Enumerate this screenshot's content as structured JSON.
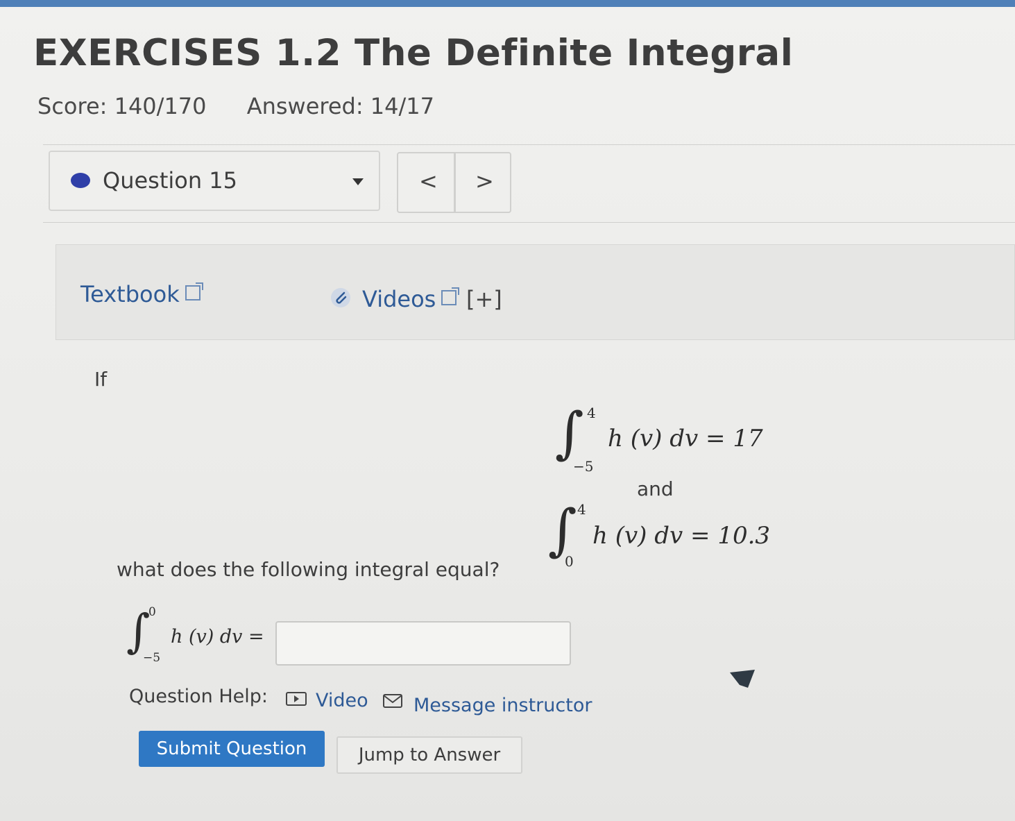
{
  "header": {
    "title": "EXERCISES 1.2 The Definite Integral",
    "score_label": "Score: 140/170",
    "answered_label": "Answered: 14/17"
  },
  "question_nav": {
    "current_label": "Question 15",
    "prev_symbol": "<",
    "next_symbol": ">"
  },
  "resources": {
    "textbook_label": "Textbook",
    "videos_label": "Videos",
    "expand_label": "[+]"
  },
  "problem": {
    "intro": "If",
    "integral1": {
      "lower": "−5",
      "upper": "4",
      "expression": "h (v) dv = 17"
    },
    "connector": "and",
    "integral2": {
      "lower": "0",
      "upper": "4",
      "expression": "h (v) dv = 10.3"
    },
    "question": "what does the following integral equal?",
    "answer_integral": {
      "lower": "−5",
      "upper": "0",
      "expression": "h (v) dv ="
    },
    "answer_value": ""
  },
  "help": {
    "label": "Question Help:",
    "video_label": "Video",
    "message_label": "Message instructor"
  },
  "actions": {
    "submit_label": "Submit Question",
    "jump_label": "Jump to Answer"
  },
  "colors": {
    "link": "#2e5a96",
    "submit": "#2f78c4",
    "question_dot": "#2f3fa8"
  }
}
